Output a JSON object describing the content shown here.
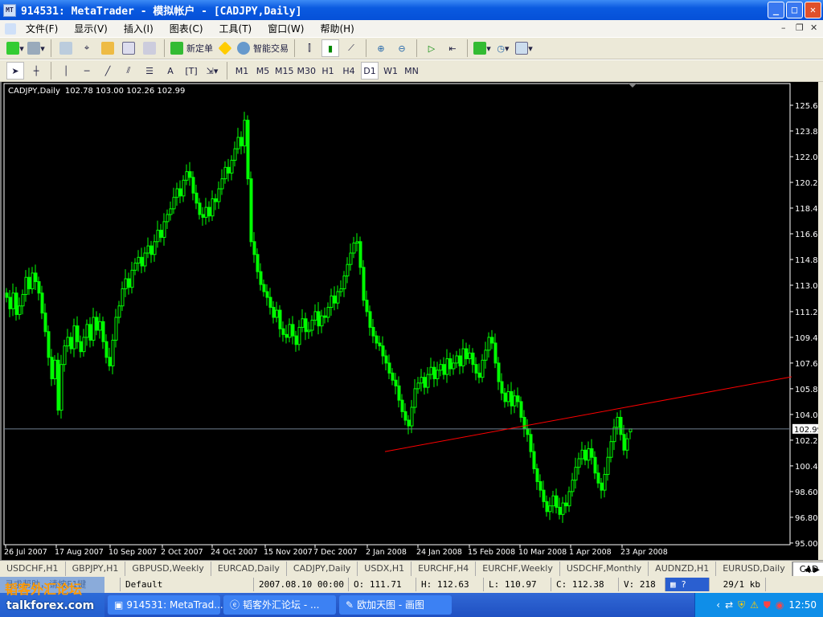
{
  "window": {
    "title": "914531: MetaTrader - 模拟帐户 - [CADJPY,Daily]"
  },
  "menu": [
    "文件(F)",
    "显示(V)",
    "插入(I)",
    "图表(C)",
    "工具(T)",
    "窗口(W)",
    "帮助(H)"
  ],
  "toolbar1": {
    "new_order": "新定单",
    "expert_advisors": "智能交易"
  },
  "toolbar2": {
    "timeframes": [
      "M1",
      "M5",
      "M15",
      "M30",
      "H1",
      "H4",
      "D1",
      "W1",
      "MN"
    ],
    "selected": "D1",
    "text_tool": "A"
  },
  "chart": {
    "header": "CADJPY,Daily",
    "ohlc": "102.78 103.00 102.26 102.99",
    "bull_color": "#00ff00",
    "trendline_color": "#ff0000",
    "bidline_color": "#708090"
  },
  "chart_data": {
    "type": "candlestick",
    "symbol": "CADJPY",
    "timeframe": "Daily",
    "ylim": [
      95.0,
      126.2
    ],
    "yticks": [
      "125.65",
      "123.85",
      "122.05",
      "120.25",
      "118.45",
      "116.65",
      "114.85",
      "113.05",
      "111.20",
      "109.40",
      "107.60",
      "105.80",
      "104.00",
      "102.20",
      "100.40",
      "98.60",
      "96.80",
      "95.00"
    ],
    "xticks": [
      "26 Jul 2007",
      "17 Aug 2007",
      "10 Sep 2007",
      "2 Oct 2007",
      "24 Oct 2007",
      "15 Nov 2007",
      "7 Dec 2007",
      "2 Jan 2008",
      "24 Jan 2008",
      "15 Feb 2008",
      "10 Mar 2008",
      "1 Apr 2008",
      "23 Apr 2008"
    ],
    "closes": [
      112.2,
      111.4,
      112.5,
      111.0,
      111.6,
      112.4,
      113.6,
      112.8,
      113.9,
      113.3,
      112.5,
      111.1,
      109.8,
      108.0,
      106.5,
      107.8,
      104.3,
      107.5,
      108.8,
      109.4,
      108.6,
      110.2,
      109.1,
      108.4,
      109.4,
      110.3,
      109.2,
      110.8,
      109.9,
      110.5,
      109.1,
      108.0,
      107.4,
      109.2,
      110.8,
      111.6,
      112.8,
      113.5,
      112.9,
      114.1,
      114.6,
      115.0,
      114.4,
      115.3,
      115.8,
      115.2,
      116.1,
      116.9,
      116.4,
      117.5,
      118.0,
      118.4,
      119.2,
      119.8,
      119.3,
      120.4,
      121.0,
      120.6,
      119.5,
      118.8,
      118.0,
      117.8,
      118.5,
      117.9,
      119.1,
      118.9,
      119.8,
      120.5,
      121.3,
      120.9,
      121.8,
      122.6,
      123.4,
      122.8,
      124.6,
      120.5,
      116.1,
      115.2,
      114.0,
      113.1,
      112.6,
      112.2,
      111.5,
      110.8,
      111.3,
      110.0,
      109.6,
      109.4,
      110.3,
      109.5,
      108.9,
      110.1,
      110.7,
      109.8,
      109.9,
      110.6,
      111.2,
      110.2,
      110.9,
      110.8,
      111.5,
      112.3,
      111.8,
      112.6,
      112.8,
      113.7,
      114.5,
      115.3,
      116.0,
      116.1,
      114.3,
      112.0,
      111.2,
      110.1,
      109.5,
      109.0,
      108.8,
      108.1,
      107.6,
      106.9,
      106.4,
      106.0,
      105.0,
      104.2,
      103.6,
      103.2,
      104.5,
      105.8,
      106.2,
      106.6,
      105.9,
      106.8,
      107.3,
      106.5,
      107.1,
      107.5,
      106.8,
      107.9,
      107.2,
      107.6,
      108.1,
      107.4,
      108.6,
      107.9,
      108.3,
      107.5,
      106.9,
      106.6,
      107.8,
      108.5,
      109.4,
      109.0,
      107.6,
      106.3,
      105.5,
      104.9,
      105.6,
      104.6,
      105.3,
      104.9,
      103.8,
      103.0,
      102.6,
      101.4,
      100.2,
      99.3,
      98.7,
      97.9,
      97.2,
      97.6,
      98.3,
      97.5,
      97.0,
      97.8,
      97.6,
      98.6,
      99.4,
      100.3,
      100.9,
      101.5,
      100.8,
      101.6,
      101.0,
      99.9,
      99.2,
      98.7,
      99.8,
      101.0,
      102.1,
      103.1,
      103.8,
      102.6,
      101.5,
      102.3,
      102.99
    ],
    "last_bar": {
      "open": 102.78,
      "high": 103.0,
      "low": 102.26,
      "close": 102.99
    },
    "bid_line": 102.99,
    "bid_label": "102.99",
    "trendline": {
      "from_bar": 118,
      "from_price": 101.4,
      "to_bar": 244.5,
      "to_price": 106.64
    }
  },
  "tabs": [
    "USDCHF,H1",
    "GBPJPY,H1",
    "GBPUSD,Weekly",
    "EURCAD,Daily",
    "CADJPY,Daily",
    "USDX,H1",
    "EURCHF,H4",
    "EURCHF,Weekly",
    "USDCHF,Monthly",
    "AUDNZD,H1",
    "EURUSD,Daily",
    "CAD"
  ],
  "status": {
    "help": "寻求帮助，请按F1键",
    "profile": "Default",
    "datetime": "2007.08.10 00:00",
    "open": "O: 111.71",
    "high": "H: 112.63",
    "low": "L: 110.97",
    "close": "C: 112.38",
    "volume": "V: 218",
    "traffic": "29/1 kb"
  },
  "taskbar": {
    "tasks": [
      "914531: MetaTrad...",
      "韬客外汇论坛 - ...",
      "欧加天图 - 画图"
    ],
    "clock": "12:50"
  },
  "watermark": {
    "cn": "韬客外汇论坛",
    "en": "talkforex.com"
  }
}
